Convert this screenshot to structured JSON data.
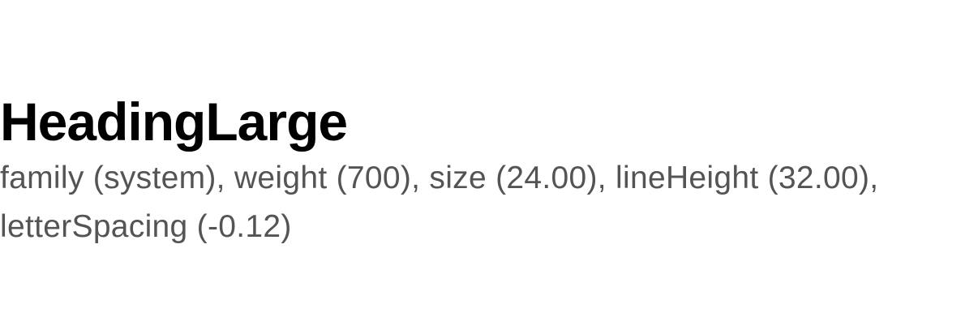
{
  "sample": {
    "title": "HeadingLarge",
    "spec": "family (system), weight (700), size (24.00), lineHeight (32.00), letterSpacing (-0.12)"
  },
  "colors": {
    "background": "#ffffff",
    "title": "#000000",
    "spec": "#545456"
  }
}
